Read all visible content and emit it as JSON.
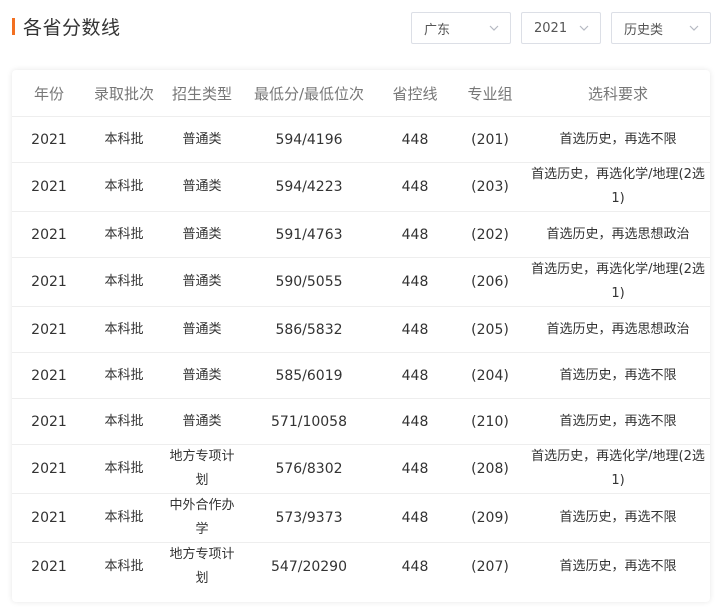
{
  "header": {
    "title": "各省分数线"
  },
  "filters": {
    "province": "广东",
    "year": "2021",
    "subject": "历史类"
  },
  "icons": {
    "dropdown": "chevron-down-icon"
  },
  "colors": {
    "accent": "#f37021"
  },
  "table": {
    "columns": [
      "年份",
      "录取批次",
      "招生类型",
      "最低分/最低位次",
      "省控线",
      "专业组",
      "选科要求"
    ],
    "rows": [
      [
        "2021",
        "本科批",
        "普通类",
        "594/4196",
        "448",
        "(201)",
        "首选历史，再选不限"
      ],
      [
        "2021",
        "本科批",
        "普通类",
        "594/4223",
        "448",
        "(203)",
        "首选历史，再选化学/地理(2选1)"
      ],
      [
        "2021",
        "本科批",
        "普通类",
        "591/4763",
        "448",
        "(202)",
        "首选历史，再选思想政治"
      ],
      [
        "2021",
        "本科批",
        "普通类",
        "590/5055",
        "448",
        "(206)",
        "首选历史，再选化学/地理(2选1)"
      ],
      [
        "2021",
        "本科批",
        "普通类",
        "586/5832",
        "448",
        "(205)",
        "首选历史，再选思想政治"
      ],
      [
        "2021",
        "本科批",
        "普通类",
        "585/6019",
        "448",
        "(204)",
        "首选历史，再选不限"
      ],
      [
        "2021",
        "本科批",
        "普通类",
        "571/10058",
        "448",
        "(210)",
        "首选历史，再选不限"
      ],
      [
        "2021",
        "本科批",
        "地方专项计划",
        "576/8302",
        "448",
        "(208)",
        "首选历史，再选化学/地理(2选1)"
      ],
      [
        "2021",
        "本科批",
        "中外合作办学",
        "573/9373",
        "448",
        "(209)",
        "首选历史，再选不限"
      ],
      [
        "2021",
        "本科批",
        "地方专项计划",
        "547/20290",
        "448",
        "(207)",
        "首选历史，再选不限"
      ]
    ]
  }
}
